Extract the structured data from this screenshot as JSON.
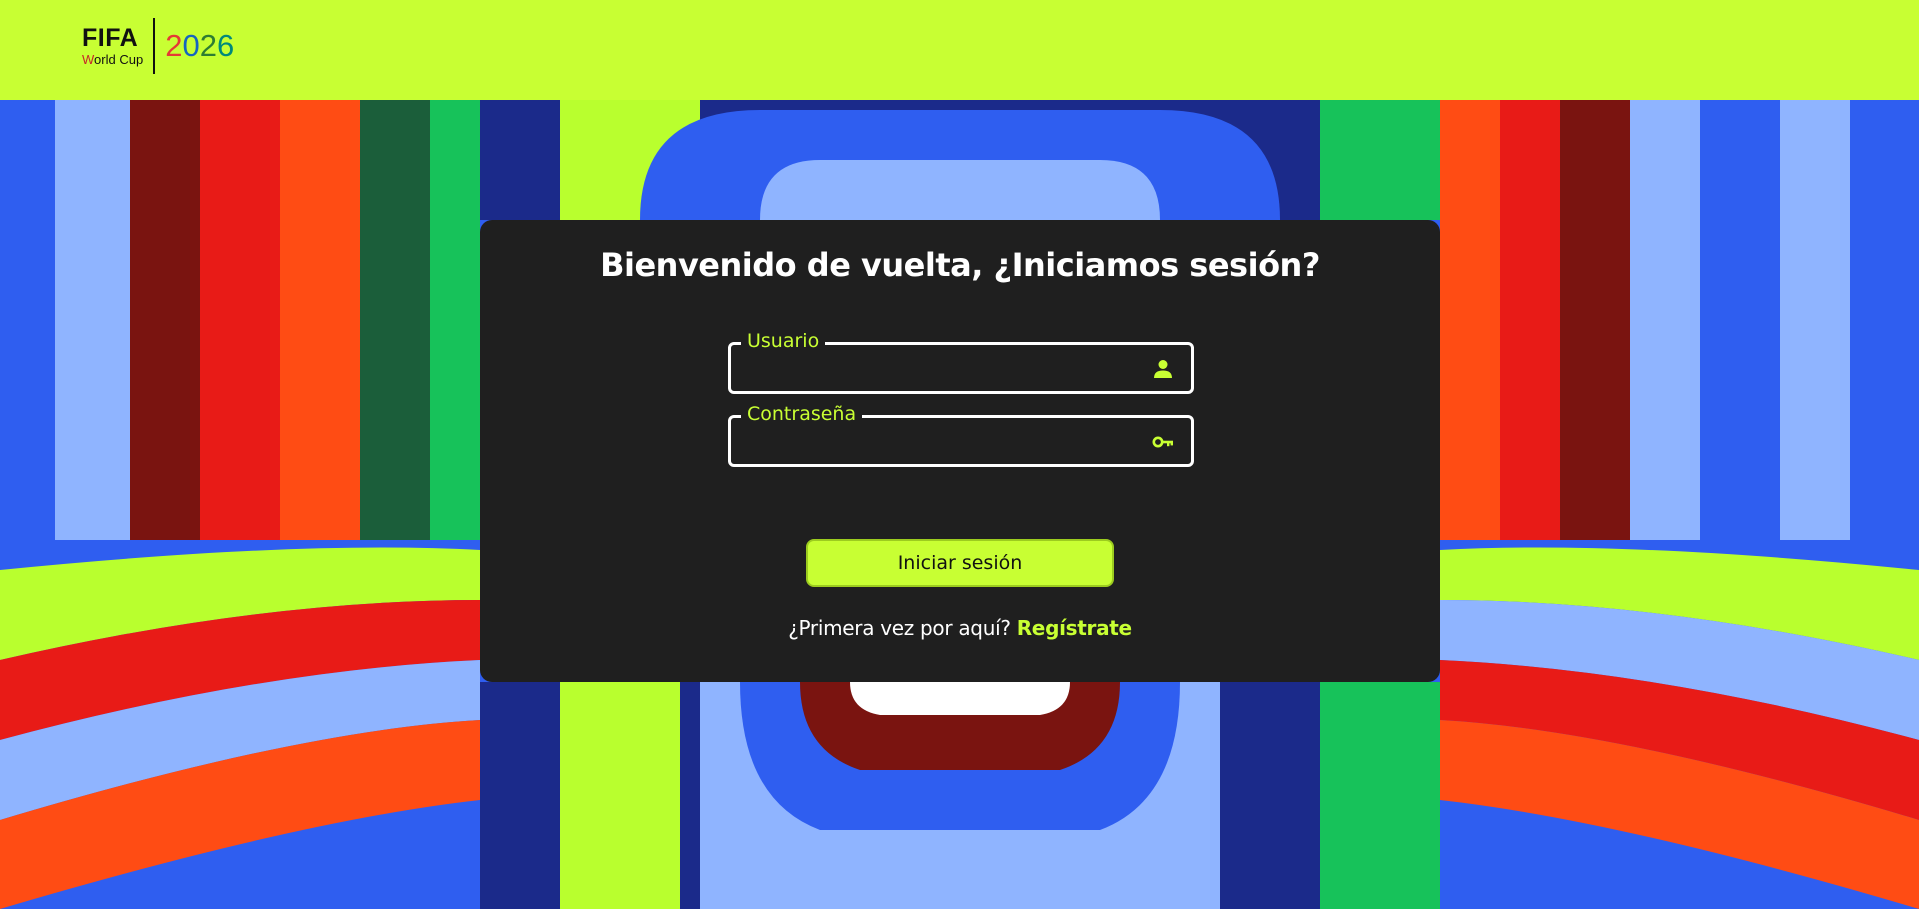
{
  "header": {
    "logo": {
      "brand": "FIFA",
      "subtitle_first_letter": "W",
      "subtitle_rest": "orld Cup",
      "year_digits": [
        "2",
        "0",
        "2",
        "6"
      ]
    },
    "background_color": "#c8ff33"
  },
  "login_card": {
    "title": "Bienvenido de vuelta, ¿Iniciamos sesión?",
    "username": {
      "label": "Usuario",
      "value": "",
      "placeholder": "",
      "icon": "user-icon"
    },
    "password": {
      "label": "Contraseña",
      "value": "",
      "placeholder": "",
      "icon": "key-icon"
    },
    "submit_label": "Iniciar sesión",
    "signup_prompt": "¿Primera vez por aquí?",
    "signup_link": "Regístrate"
  },
  "colors": {
    "accent": "#c8ff33",
    "card_bg": "#1f1f1f",
    "text": "#ffffff"
  }
}
